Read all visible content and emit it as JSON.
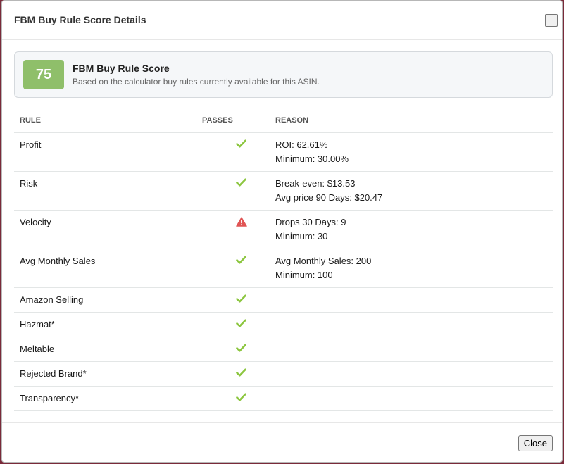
{
  "modal": {
    "title": "FBM Buy Rule Score Details",
    "close_label": "Close"
  },
  "score": {
    "value": "75",
    "title": "FBM Buy Rule Score",
    "subtitle": "Based on the calculator buy rules currently available for this ASIN.",
    "badge_color": "#8fbf6a"
  },
  "table": {
    "headers": {
      "rule": "RULE",
      "passes": "PASSES",
      "reason": "REASON"
    },
    "rows": [
      {
        "rule": "Profit",
        "passes": true,
        "status_icon": "check-icon",
        "reason": [
          "ROI: 62.61%",
          "Minimum: 30.00%"
        ]
      },
      {
        "rule": "Risk",
        "passes": true,
        "status_icon": "check-icon",
        "reason": [
          "Break-even: $13.53",
          "Avg price 90 Days: $20.47"
        ]
      },
      {
        "rule": "Velocity",
        "passes": false,
        "status_icon": "warning-icon",
        "reason": [
          "Drops 30 Days: 9",
          "Minimum: 30"
        ]
      },
      {
        "rule": "Avg Monthly Sales",
        "passes": true,
        "status_icon": "check-icon",
        "reason": [
          "Avg Monthly Sales: 200",
          "Minimum: 100"
        ]
      },
      {
        "rule": "Amazon Selling",
        "passes": true,
        "status_icon": "check-icon",
        "reason": []
      },
      {
        "rule": "Hazmat*",
        "passes": true,
        "status_icon": "check-icon",
        "reason": []
      },
      {
        "rule": "Meltable",
        "passes": true,
        "status_icon": "check-icon",
        "reason": []
      },
      {
        "rule": "Rejected Brand*",
        "passes": true,
        "status_icon": "check-icon",
        "reason": []
      },
      {
        "rule": "Transparency*",
        "passes": true,
        "status_icon": "check-icon",
        "reason": []
      }
    ]
  },
  "colors": {
    "pass": "#8cc63f",
    "fail": "#e05555"
  }
}
